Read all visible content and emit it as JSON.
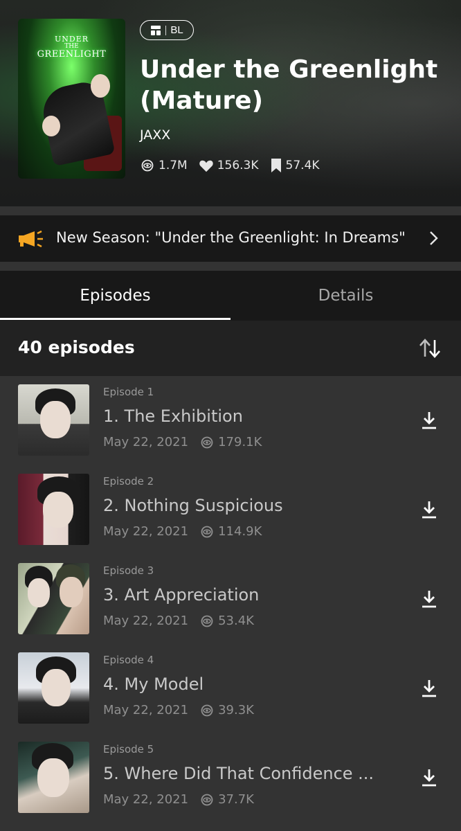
{
  "series": {
    "cover_title_line1": "UNDER",
    "cover_title_line2": "THE",
    "cover_title_line3": "GREENLIGHT",
    "genre": "BL",
    "title": "Under the Greenlight (Mature)",
    "author": "JAXX",
    "stats": {
      "views": "1.7M",
      "likes": "156.3K",
      "subscribers": "57.4K"
    }
  },
  "banner": {
    "text": "New Season: \"Under the Greenlight: In Dreams\""
  },
  "tabs": [
    {
      "label": "Episodes",
      "active": true
    },
    {
      "label": "Details",
      "active": false
    }
  ],
  "episode_count": "40 episodes",
  "episodes": [
    {
      "label": "Episode 1",
      "title": "1. The Exhibition",
      "date": "May 22, 2021",
      "views": "179.1K"
    },
    {
      "label": "Episode 2",
      "title": "2. Nothing Suspicious",
      "date": "May 22, 2021",
      "views": "114.9K"
    },
    {
      "label": "Episode 3",
      "title": "3. Art Appreciation",
      "date": "May 22, 2021",
      "views": "53.4K"
    },
    {
      "label": "Episode 4",
      "title": "4. My Model",
      "date": "May 22, 2021",
      "views": "39.3K"
    },
    {
      "label": "Episode 5",
      "title": "5. Where Did That Confidence ...",
      "date": "May 22, 2021",
      "views": "37.7K"
    }
  ],
  "colors": {
    "background": "#333333",
    "header_dark": "#1b1c1c",
    "banner_bg": "#181818",
    "accent_megaphone": "#f5a623",
    "active_tab": "#ffffff",
    "inactive_tab": "#a8a8a8"
  }
}
